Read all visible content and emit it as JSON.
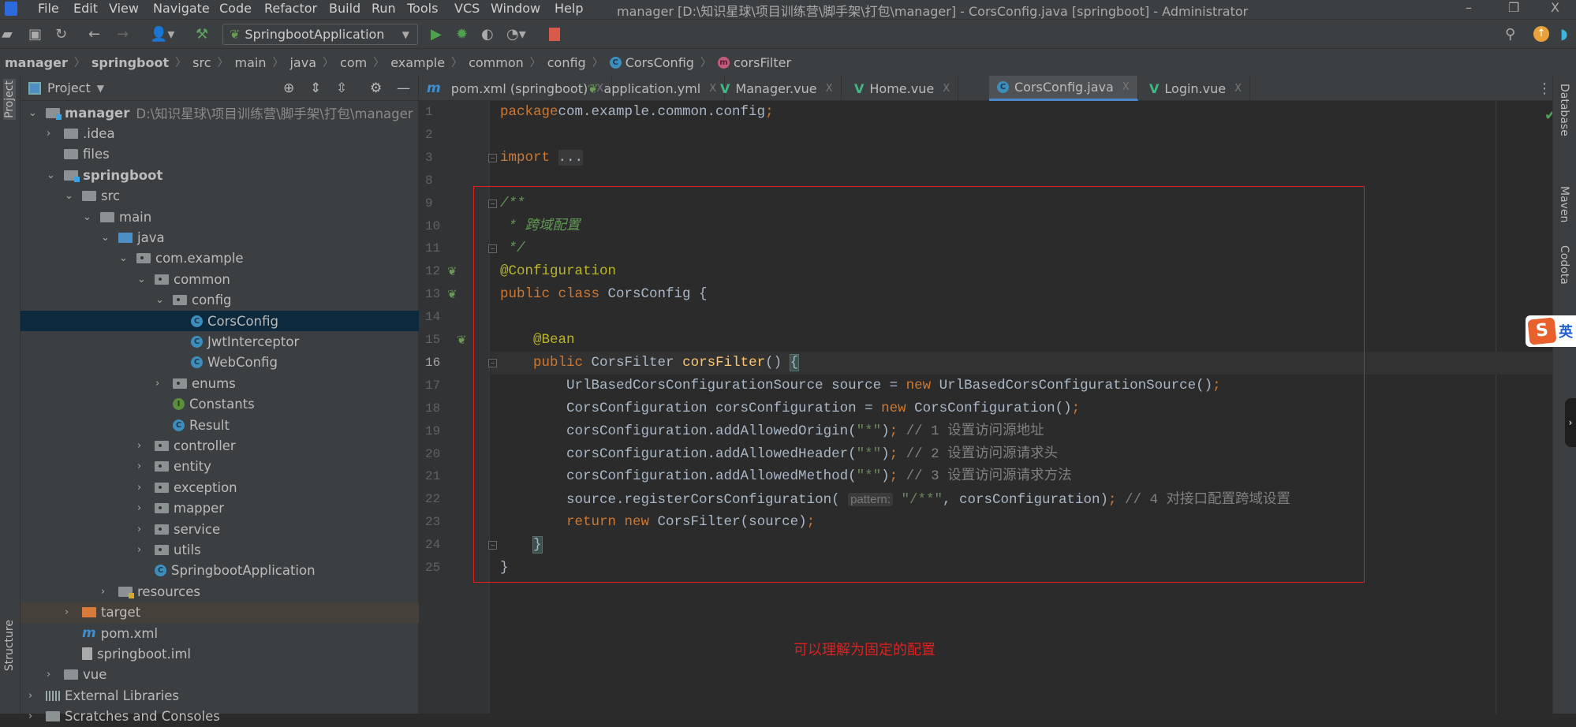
{
  "titlebar": {
    "menus": [
      "File",
      "Edit",
      "View",
      "Navigate",
      "Code",
      "Refactor",
      "Build",
      "Run",
      "Tools",
      "VCS",
      "Window",
      "Help"
    ],
    "title": "manager [D:\\知识星球\\项目训练营\\脚手架\\打包\\manager] - CorsConfig.java [springboot] - Administrator",
    "minimize": "–",
    "restore": "❐",
    "close": "X"
  },
  "toolbar": {
    "run_config": "SpringbootApplication"
  },
  "breadcrumb": [
    {
      "label": "manager",
      "bold": true
    },
    {
      "label": "springboot",
      "bold": true
    },
    {
      "label": "src"
    },
    {
      "label": "main"
    },
    {
      "label": "java"
    },
    {
      "label": "com"
    },
    {
      "label": "example"
    },
    {
      "label": "common"
    },
    {
      "label": "config"
    },
    {
      "label": "CorsConfig",
      "icon": "class-icon"
    },
    {
      "label": "corsFilter",
      "icon": "method-icon"
    }
  ],
  "left_strip": {
    "project": "Project",
    "structure": "Structure"
  },
  "project_panel": {
    "title": "Project",
    "tree": [
      {
        "label": "manager",
        "depth": 0,
        "arrow": "open",
        "icon": "module",
        "bold": true,
        "hint": "D:\\知识星球\\项目训练营\\脚手架\\打包\\manager"
      },
      {
        "label": ".idea",
        "depth": 1,
        "arrow": "closed",
        "icon": "folder"
      },
      {
        "label": "files",
        "depth": 1,
        "arrow": "none",
        "icon": "folder"
      },
      {
        "label": "springboot",
        "depth": 1,
        "arrow": "open",
        "icon": "module",
        "bold": true
      },
      {
        "label": "src",
        "depth": 2,
        "arrow": "open",
        "icon": "folder"
      },
      {
        "label": "main",
        "depth": 3,
        "arrow": "open",
        "icon": "folder"
      },
      {
        "label": "java",
        "depth": 4,
        "arrow": "open",
        "icon": "blue"
      },
      {
        "label": "com.example",
        "depth": 5,
        "arrow": "open",
        "icon": "pkg"
      },
      {
        "label": "common",
        "depth": 6,
        "arrow": "open",
        "icon": "pkg"
      },
      {
        "label": "config",
        "depth": 7,
        "arrow": "open",
        "icon": "pkg"
      },
      {
        "label": "CorsConfig",
        "depth": 8,
        "arrow": "none",
        "icon": "class",
        "selected": true
      },
      {
        "label": "JwtInterceptor",
        "depth": 8,
        "arrow": "none",
        "icon": "class"
      },
      {
        "label": "WebConfig",
        "depth": 8,
        "arrow": "none",
        "icon": "class"
      },
      {
        "label": "enums",
        "depth": 7,
        "arrow": "closed",
        "icon": "pkg"
      },
      {
        "label": "Constants",
        "depth": 7,
        "arrow": "none",
        "icon": "interface"
      },
      {
        "label": "Result",
        "depth": 7,
        "arrow": "none",
        "icon": "class"
      },
      {
        "label": "controller",
        "depth": 6,
        "arrow": "closed",
        "icon": "pkg"
      },
      {
        "label": "entity",
        "depth": 6,
        "arrow": "closed",
        "icon": "pkg"
      },
      {
        "label": "exception",
        "depth": 6,
        "arrow": "closed",
        "icon": "pkg"
      },
      {
        "label": "mapper",
        "depth": 6,
        "arrow": "closed",
        "icon": "pkg"
      },
      {
        "label": "service",
        "depth": 6,
        "arrow": "closed",
        "icon": "pkg"
      },
      {
        "label": "utils",
        "depth": 6,
        "arrow": "closed",
        "icon": "pkg"
      },
      {
        "label": "SpringbootApplication",
        "depth": 6,
        "arrow": "none",
        "icon": "class"
      },
      {
        "label": "resources",
        "depth": 4,
        "arrow": "closed",
        "icon": "res"
      },
      {
        "label": "target",
        "depth": 2,
        "arrow": "closed",
        "icon": "orange",
        "highlight": true
      },
      {
        "label": "pom.xml",
        "depth": 2,
        "arrow": "none",
        "icon": "maven"
      },
      {
        "label": "springboot.iml",
        "depth": 2,
        "arrow": "none",
        "icon": "iml"
      },
      {
        "label": "vue",
        "depth": 1,
        "arrow": "closed",
        "icon": "folder"
      },
      {
        "label": "External Libraries",
        "depth": 0,
        "arrow": "closed",
        "icon": "libs"
      },
      {
        "label": "Scratches and Consoles",
        "depth": 0,
        "arrow": "closed",
        "icon": "folder"
      }
    ]
  },
  "tabs": [
    {
      "label": "pom.xml (springboot)",
      "icon": "maven"
    },
    {
      "label": "application.yml",
      "icon": "spring"
    },
    {
      "label": "Manager.vue",
      "icon": "vue"
    },
    {
      "label": "Home.vue",
      "icon": "vue"
    },
    {
      "label": "CorsConfig.java",
      "icon": "class",
      "active": true
    },
    {
      "label": "Login.vue",
      "icon": "vue"
    }
  ],
  "editor": {
    "current_line": 16,
    "lines": [
      {
        "n": 1,
        "t": [
          [
            "kw",
            "package"
          ],
          [
            "",
            "com.example.common.config"
          ],
          [
            "kw",
            ";"
          ]
        ]
      },
      {
        "n": 2,
        "t": []
      },
      {
        "n": 3,
        "fold": true,
        "t": [
          [
            "kw",
            "import"
          ],
          [
            "",
            " "
          ],
          [
            "fold-txt",
            "..."
          ]
        ]
      },
      {
        "n": 8,
        "t": []
      },
      {
        "n": 9,
        "fold": true,
        "t": [
          [
            "doc",
            "/**"
          ]
        ]
      },
      {
        "n": 10,
        "t": [
          [
            "doc",
            " * 跨域配置"
          ]
        ]
      },
      {
        "n": 11,
        "fold": true,
        "t": [
          [
            "doc",
            " */"
          ]
        ]
      },
      {
        "n": 12,
        "gicon": "bean-icon",
        "t": [
          [
            "ann",
            "@Configuration"
          ]
        ]
      },
      {
        "n": 13,
        "gicon": "bean-icon",
        "t": [
          [
            "kw",
            "public class"
          ],
          [
            "",
            " CorsConfig {"
          ]
        ]
      },
      {
        "n": 14,
        "t": []
      },
      {
        "n": 15,
        "gicon": "bean-icon",
        "t": [
          [
            "",
            "    "
          ],
          [
            "ann",
            "@Bean"
          ]
        ]
      },
      {
        "n": 16,
        "fold": true,
        "t": [
          [
            "",
            "    "
          ],
          [
            "kw",
            "public"
          ],
          [
            "",
            " CorsFilter "
          ],
          [
            "fn",
            "corsFilter"
          ],
          [
            "",
            "() "
          ],
          [
            "brk",
            "{"
          ]
        ]
      },
      {
        "n": 17,
        "t": [
          [
            "",
            "        UrlBasedCorsConfigurationSource source = "
          ],
          [
            "kw",
            "new"
          ],
          [
            "",
            " UrlBasedCorsConfigurationSource()"
          ],
          [
            "kw",
            ";"
          ]
        ]
      },
      {
        "n": 18,
        "t": [
          [
            "",
            "        CorsConfiguration corsConfiguration = "
          ],
          [
            "kw",
            "new"
          ],
          [
            "",
            " CorsConfiguration()"
          ],
          [
            "kw",
            ";"
          ]
        ]
      },
      {
        "n": 19,
        "t": [
          [
            "",
            "        corsConfiguration.addAllowedOrigin("
          ],
          [
            "str",
            "\"*\""
          ],
          [
            "",
            ")"
          ],
          [
            "kw",
            ";"
          ],
          [
            "cm",
            " // 1 设置访问源地址"
          ]
        ]
      },
      {
        "n": 20,
        "t": [
          [
            "",
            "        corsConfiguration.addAllowedHeader("
          ],
          [
            "str",
            "\"*\""
          ],
          [
            "",
            ")"
          ],
          [
            "kw",
            ";"
          ],
          [
            "cm",
            " // 2 设置访问源请求头"
          ]
        ]
      },
      {
        "n": 21,
        "t": [
          [
            "",
            "        corsConfiguration.addAllowedMethod("
          ],
          [
            "str",
            "\"*\""
          ],
          [
            "",
            ")"
          ],
          [
            "kw",
            ";"
          ],
          [
            "cm",
            " // 3 设置访问源请求方法"
          ]
        ]
      },
      {
        "n": 22,
        "t": [
          [
            "",
            "        source.registerCorsConfiguration( "
          ],
          [
            "hint",
            "pattern:"
          ],
          [
            "str",
            " \"/**\""
          ],
          [
            "",
            ", corsConfiguration)"
          ],
          [
            "kw",
            ";"
          ],
          [
            "cm",
            " // 4 对接口配置跨域设置"
          ]
        ]
      },
      {
        "n": 23,
        "t": [
          [
            "",
            "        "
          ],
          [
            "kw",
            "return new"
          ],
          [
            "",
            " CorsFilter(source)"
          ],
          [
            "kw",
            ";"
          ]
        ]
      },
      {
        "n": 24,
        "fold": true,
        "t": [
          [
            "",
            "    "
          ],
          [
            "brk",
            "}"
          ]
        ]
      },
      {
        "n": 25,
        "t": [
          [
            "",
            "}"
          ]
        ]
      }
    ],
    "annotation_note": "可以理解为固定的配置"
  },
  "right_strip": {
    "items": [
      "Database",
      "Maven",
      "Codota"
    ]
  },
  "ime": {
    "logo": "S",
    "mode": "英"
  },
  "colors": {
    "annotation_box": "#e02020",
    "accent": "#4a88c7"
  }
}
